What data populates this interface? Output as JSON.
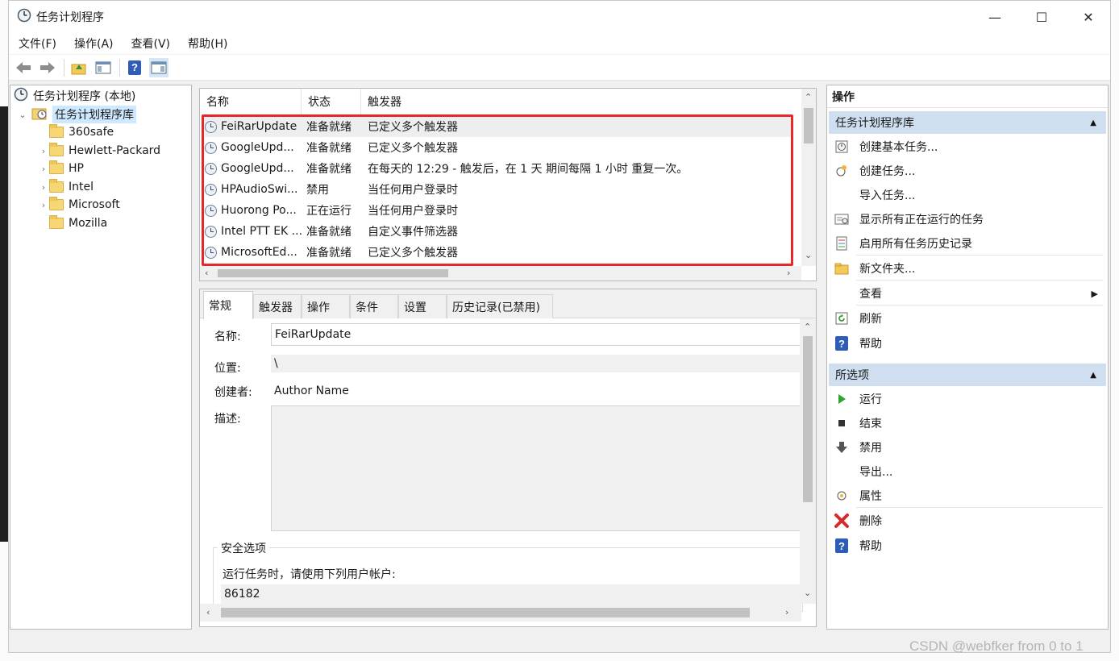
{
  "window": {
    "title": "任务计划程序",
    "minimize": "—",
    "maximize": "☐",
    "close": "✕"
  },
  "menu": [
    "文件(F)",
    "操作(A)",
    "查看(V)",
    "帮助(H)"
  ],
  "toolbar": {
    "icons": [
      "back-icon",
      "forward-icon",
      "up-folder-icon",
      "show-hide-console-tree-icon",
      "help-icon",
      "show-hide-action-pane-icon"
    ]
  },
  "tree": {
    "root": "任务计划程序 (本地)",
    "library": "任务计划程序库",
    "folders": [
      {
        "name": "360safe",
        "expandable": false
      },
      {
        "name": "Hewlett-Packard",
        "expandable": true
      },
      {
        "name": "HP",
        "expandable": true
      },
      {
        "name": "Intel",
        "expandable": true
      },
      {
        "name": "Microsoft",
        "expandable": true
      },
      {
        "name": "Mozilla",
        "expandable": false
      }
    ]
  },
  "task_list": {
    "columns": [
      "名称",
      "状态",
      "触发器"
    ],
    "rows": [
      {
        "name": "FeiRarUpdate",
        "status": "准备就绪",
        "trigger": "已定义多个触发器"
      },
      {
        "name": "GoogleUpd...",
        "status": "准备就绪",
        "trigger": "已定义多个触发器"
      },
      {
        "name": "GoogleUpd...",
        "status": "准备就绪",
        "trigger": "在每天的 12:29 - 触发后，在 1 天 期间每隔 1 小时 重复一次。"
      },
      {
        "name": "HPAudioSwi...",
        "status": "禁用",
        "trigger": "当任何用户登录时"
      },
      {
        "name": "Huorong Po...",
        "status": "正在运行",
        "trigger": "当任何用户登录时"
      },
      {
        "name": "Intel PTT EK ...",
        "status": "准备就绪",
        "trigger": "自定义事件筛选器"
      },
      {
        "name": "MicrosoftEd...",
        "status": "准备就绪",
        "trigger": "已定义多个触发器"
      }
    ]
  },
  "details": {
    "tabs": [
      "常规",
      "触发器",
      "操作",
      "条件",
      "设置",
      "历史记录(已禁用)"
    ],
    "name_label": "名称:",
    "name_value": "FeiRarUpdate",
    "location_label": "位置:",
    "location_value": "\\",
    "author_label": "创建者:",
    "author_value": "Author Name",
    "desc_label": "描述:",
    "desc_value": "",
    "security_title": "安全选项",
    "security_text": "运行任务时，请使用下列用户帐户:",
    "security_user": "86182"
  },
  "actions": {
    "header": "操作",
    "section1": "任务计划程序库",
    "items1": [
      {
        "label": "创建基本任务...",
        "icon": "create-basic-task-icon"
      },
      {
        "label": "创建任务...",
        "icon": "create-task-icon"
      },
      {
        "label": "导入任务...",
        "icon": ""
      },
      {
        "label": "显示所有正在运行的任务",
        "icon": "running-tasks-icon"
      },
      {
        "label": "启用所有任务历史记录",
        "icon": "history-icon"
      },
      {
        "label": "新文件夹...",
        "icon": "new-folder-icon"
      },
      {
        "label": "查看",
        "icon": "",
        "submenu": true
      },
      {
        "label": "刷新",
        "icon": "refresh-icon"
      },
      {
        "label": "帮助",
        "icon": "help-icon"
      }
    ],
    "section2": "所选项",
    "items2": [
      {
        "label": "运行",
        "icon": "run-icon"
      },
      {
        "label": "结束",
        "icon": "end-icon"
      },
      {
        "label": "禁用",
        "icon": "disable-icon"
      },
      {
        "label": "导出...",
        "icon": ""
      },
      {
        "label": "属性",
        "icon": "properties-icon"
      },
      {
        "label": "删除",
        "icon": "delete-icon"
      },
      {
        "label": "帮助",
        "icon": "help-icon"
      }
    ]
  },
  "watermark": "CSDN @webfker from 0 to 1",
  "colors": {
    "highlight_box": "#e8272a",
    "section_header": "#cfdff0",
    "tree_selection": "#cde8ff"
  }
}
